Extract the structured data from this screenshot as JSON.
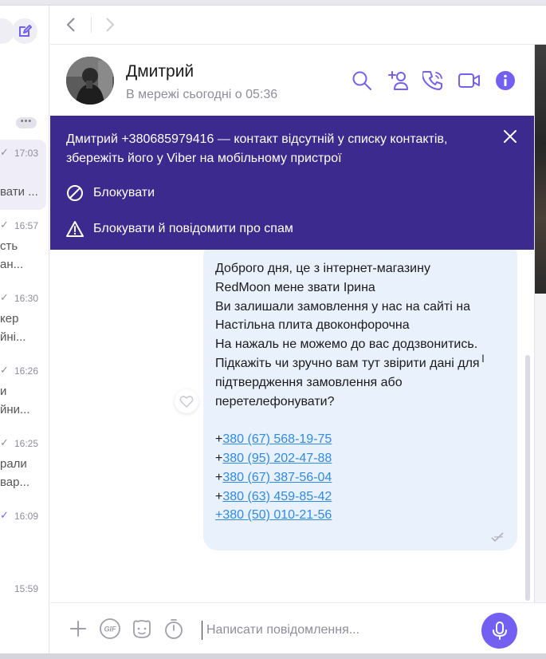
{
  "navigation": {
    "back_label": "‹",
    "forward_label": "›"
  },
  "sidebar": {
    "more_label": "•••",
    "chats": [
      {
        "time": "17:03",
        "preview_1": "",
        "preview_2": "вати ...",
        "read": false,
        "active": true
      },
      {
        "time": "16:57",
        "preview_1": "сть",
        "preview_2": "ан...",
        "read": false,
        "active": false
      },
      {
        "time": "16:30",
        "preview_1": "кер",
        "preview_2": "йні...",
        "read": false,
        "active": false
      },
      {
        "time": "16:26",
        "preview_1": "и",
        "preview_2": "йни...",
        "read": false,
        "active": false
      },
      {
        "time": "16:25",
        "preview_1": "рали",
        "preview_2": "вар...",
        "read": false,
        "active": false
      },
      {
        "time": "16:09",
        "preview_1": "",
        "preview_2": "",
        "read": true,
        "active": false
      },
      {
        "time": "15:59",
        "preview_1": "",
        "preview_2": "",
        "read": false,
        "active": false
      }
    ]
  },
  "header": {
    "name": "Дмитрий",
    "status": "В мережі сьогодні о 05:36"
  },
  "banner": {
    "text": "Дмитрий +380685979416 — контакт відсутній у списку контактів, збережіть його у Viber на мобільному пристрої",
    "block_label": "Блокувати",
    "block_report_label": "Блокувати й повідомити про спам"
  },
  "message": {
    "lines": [
      "Доброго дня, це з інтернет-магазину",
      "RedMoon мене звати Ірина",
      "Ви залишали замовлення у нас на сайті на",
      "Настільна плита двоконфорочна",
      "На нажаль не можемо до вас додзвонитись.",
      "Підкажіть чи зручно вам тут звірити дані для",
      "підтвердження замовлення або",
      "перетелефонувати?"
    ],
    "phones": [
      {
        "prefix": "+",
        "link": "380 (67) 568-19-75"
      },
      {
        "prefix": "+",
        "link": "380 (95) 202-47-88"
      },
      {
        "prefix": "+",
        "link": "380 (67) 387-56-04"
      },
      {
        "prefix": "+",
        "link": "380 (63) 459-85-42"
      },
      {
        "prefix": "",
        "link": "+380 (50) 010-21-56"
      }
    ]
  },
  "composer": {
    "placeholder": "Написати повідомлення...",
    "gif_label": "GIF"
  },
  "colors": {
    "accent": "#7360f2",
    "banner_bg": "#3c2a8f",
    "bubble_bg": "#e9f1fc",
    "link": "#2f8ae8"
  }
}
